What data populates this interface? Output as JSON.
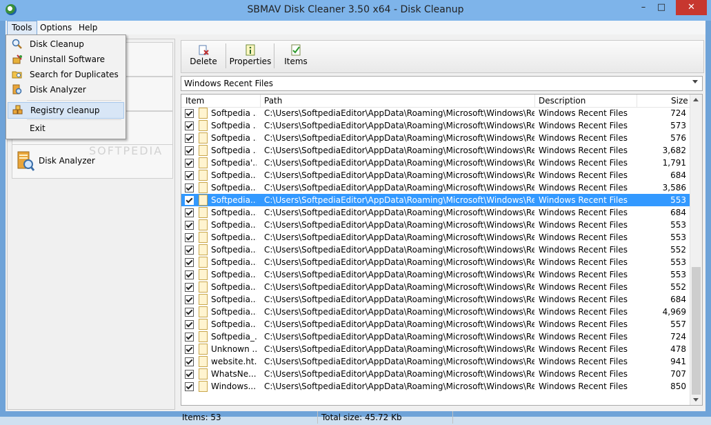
{
  "window": {
    "title": "SBMAV Disk Cleaner 3.50 x64 - Disk Cleanup",
    "min_label": "–",
    "max_label": "□",
    "close_label": "✕"
  },
  "menubar": {
    "items": [
      "Tools",
      "Options",
      "Help"
    ]
  },
  "tools_menu": {
    "items": [
      "Disk Cleanup",
      "Uninstall Software",
      "Search for Duplicates",
      "Disk Analyzer",
      "Registry cleanup",
      "Exit"
    ]
  },
  "left_nav": {
    "visible_button_label": "Disk Analyzer"
  },
  "toolbar": {
    "delete_label": "Delete",
    "properties_label": "Properties",
    "items_label": "Items"
  },
  "filter": {
    "selected": "Windows Recent Files"
  },
  "columns": {
    "item": "Item",
    "path": "Path",
    "description": "Description",
    "size": "Size"
  },
  "rows": [
    {
      "item": "Softpedia ...",
      "path": "C:\\Users\\SoftpediaEditor\\AppData\\Roaming\\Microsoft\\Windows\\Rece...",
      "desc": "Windows Recent Files",
      "size": "724"
    },
    {
      "item": "Softpedia ...",
      "path": "C:\\Users\\SoftpediaEditor\\AppData\\Roaming\\Microsoft\\Windows\\Rece...",
      "desc": "Windows Recent Files",
      "size": "573"
    },
    {
      "item": "Softpedia ...",
      "path": "C:\\Users\\SoftpediaEditor\\AppData\\Roaming\\Microsoft\\Windows\\Rece...",
      "desc": "Windows Recent Files",
      "size": "576"
    },
    {
      "item": "Softpedia ...",
      "path": "C:\\Users\\SoftpediaEditor\\AppData\\Roaming\\Microsoft\\Windows\\Rece...",
      "desc": "Windows Recent Files",
      "size": "3,682"
    },
    {
      "item": "Softpedia'...",
      "path": "C:\\Users\\SoftpediaEditor\\AppData\\Roaming\\Microsoft\\Windows\\Rece...",
      "desc": "Windows Recent Files",
      "size": "1,791"
    },
    {
      "item": "Softpedia....",
      "path": "C:\\Users\\SoftpediaEditor\\AppData\\Roaming\\Microsoft\\Windows\\Rece...",
      "desc": "Windows Recent Files",
      "size": "684"
    },
    {
      "item": "Softpedia....",
      "path": "C:\\Users\\SoftpediaEditor\\AppData\\Roaming\\Microsoft\\Windows\\Rece...",
      "desc": "Windows Recent Files",
      "size": "3,586"
    },
    {
      "item": "Softpedia....",
      "path": "C:\\Users\\SoftpediaEditor\\AppData\\Roaming\\Microsoft\\Windows\\Rece...",
      "desc": "Windows Recent Files",
      "size": "553",
      "selected": true
    },
    {
      "item": "Softpedia....",
      "path": "C:\\Users\\SoftpediaEditor\\AppData\\Roaming\\Microsoft\\Windows\\Rece...",
      "desc": "Windows Recent Files",
      "size": "684"
    },
    {
      "item": "Softpedia....",
      "path": "C:\\Users\\SoftpediaEditor\\AppData\\Roaming\\Microsoft\\Windows\\Rece...",
      "desc": "Windows Recent Files",
      "size": "553"
    },
    {
      "item": "Softpedia....",
      "path": "C:\\Users\\SoftpediaEditor\\AppData\\Roaming\\Microsoft\\Windows\\Rece...",
      "desc": "Windows Recent Files",
      "size": "553"
    },
    {
      "item": "Softpedia....",
      "path": "C:\\Users\\SoftpediaEditor\\AppData\\Roaming\\Microsoft\\Windows\\Rece...",
      "desc": "Windows Recent Files",
      "size": "552"
    },
    {
      "item": "Softpedia....",
      "path": "C:\\Users\\SoftpediaEditor\\AppData\\Roaming\\Microsoft\\Windows\\Rece...",
      "desc": "Windows Recent Files",
      "size": "553"
    },
    {
      "item": "Softpedia....",
      "path": "C:\\Users\\SoftpediaEditor\\AppData\\Roaming\\Microsoft\\Windows\\Rece...",
      "desc": "Windows Recent Files",
      "size": "553"
    },
    {
      "item": "Softpedia....",
      "path": "C:\\Users\\SoftpediaEditor\\AppData\\Roaming\\Microsoft\\Windows\\Rece...",
      "desc": "Windows Recent Files",
      "size": "552"
    },
    {
      "item": "Softpedia....",
      "path": "C:\\Users\\SoftpediaEditor\\AppData\\Roaming\\Microsoft\\Windows\\Rece...",
      "desc": "Windows Recent Files",
      "size": "684"
    },
    {
      "item": "Softpedia....",
      "path": "C:\\Users\\SoftpediaEditor\\AppData\\Roaming\\Microsoft\\Windows\\Rece...",
      "desc": "Windows Recent Files",
      "size": "4,969"
    },
    {
      "item": "Softpedia....",
      "path": "C:\\Users\\SoftpediaEditor\\AppData\\Roaming\\Microsoft\\Windows\\Rece...",
      "desc": "Windows Recent Files",
      "size": "557"
    },
    {
      "item": "Softpedia_...",
      "path": "C:\\Users\\SoftpediaEditor\\AppData\\Roaming\\Microsoft\\Windows\\Rece...",
      "desc": "Windows Recent Files",
      "size": "724"
    },
    {
      "item": "Unknown ...",
      "path": "C:\\Users\\SoftpediaEditor\\AppData\\Roaming\\Microsoft\\Windows\\Rece...",
      "desc": "Windows Recent Files",
      "size": "478"
    },
    {
      "item": "website.ht...",
      "path": "C:\\Users\\SoftpediaEditor\\AppData\\Roaming\\Microsoft\\Windows\\Rece...",
      "desc": "Windows Recent Files",
      "size": "941"
    },
    {
      "item": "WhatsNe...",
      "path": "C:\\Users\\SoftpediaEditor\\AppData\\Roaming\\Microsoft\\Windows\\Rece...",
      "desc": "Windows Recent Files",
      "size": "707"
    },
    {
      "item": "Windows....",
      "path": "C:\\Users\\SoftpediaEditor\\AppData\\Roaming\\Microsoft\\Windows\\Rece...",
      "desc": "Windows Recent Files",
      "size": "850"
    }
  ],
  "status": {
    "items": "Items: 53",
    "total": "Total size: 45.72 Kb"
  },
  "watermark": "SOFTPEDIA",
  "colors": {
    "selection": "#3399ff",
    "title_bar": "#7eb4ea",
    "close_button": "#c7372f"
  }
}
